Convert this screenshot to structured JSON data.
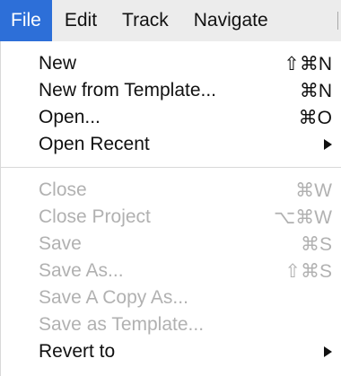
{
  "menubar": {
    "items": [
      "File",
      "Edit",
      "Track",
      "Navigate"
    ]
  },
  "menu": {
    "group1": [
      {
        "label": "New",
        "shortcut": "⇧⌘N"
      },
      {
        "label": "New from Template...",
        "shortcut": "⌘N"
      },
      {
        "label": "Open...",
        "shortcut": "⌘O"
      },
      {
        "label": "Open Recent",
        "submenu": true
      }
    ],
    "group2": [
      {
        "label": "Close",
        "shortcut": "⌘W"
      },
      {
        "label": "Close Project",
        "shortcut": "⌥⌘W"
      },
      {
        "label": "Save",
        "shortcut": "⌘S"
      },
      {
        "label": "Save As...",
        "shortcut": "⇧⌘S"
      },
      {
        "label": "Save A Copy As..."
      },
      {
        "label": "Save as Template..."
      },
      {
        "label": "Revert to",
        "submenu": true
      }
    ]
  },
  "colors": {
    "selection": "#2d6fd8",
    "disabled_text": "#b1b1b1",
    "menubar_bg": "#ececec"
  },
  "icons": {
    "submenu": "right-triangle-arrow-icon"
  }
}
